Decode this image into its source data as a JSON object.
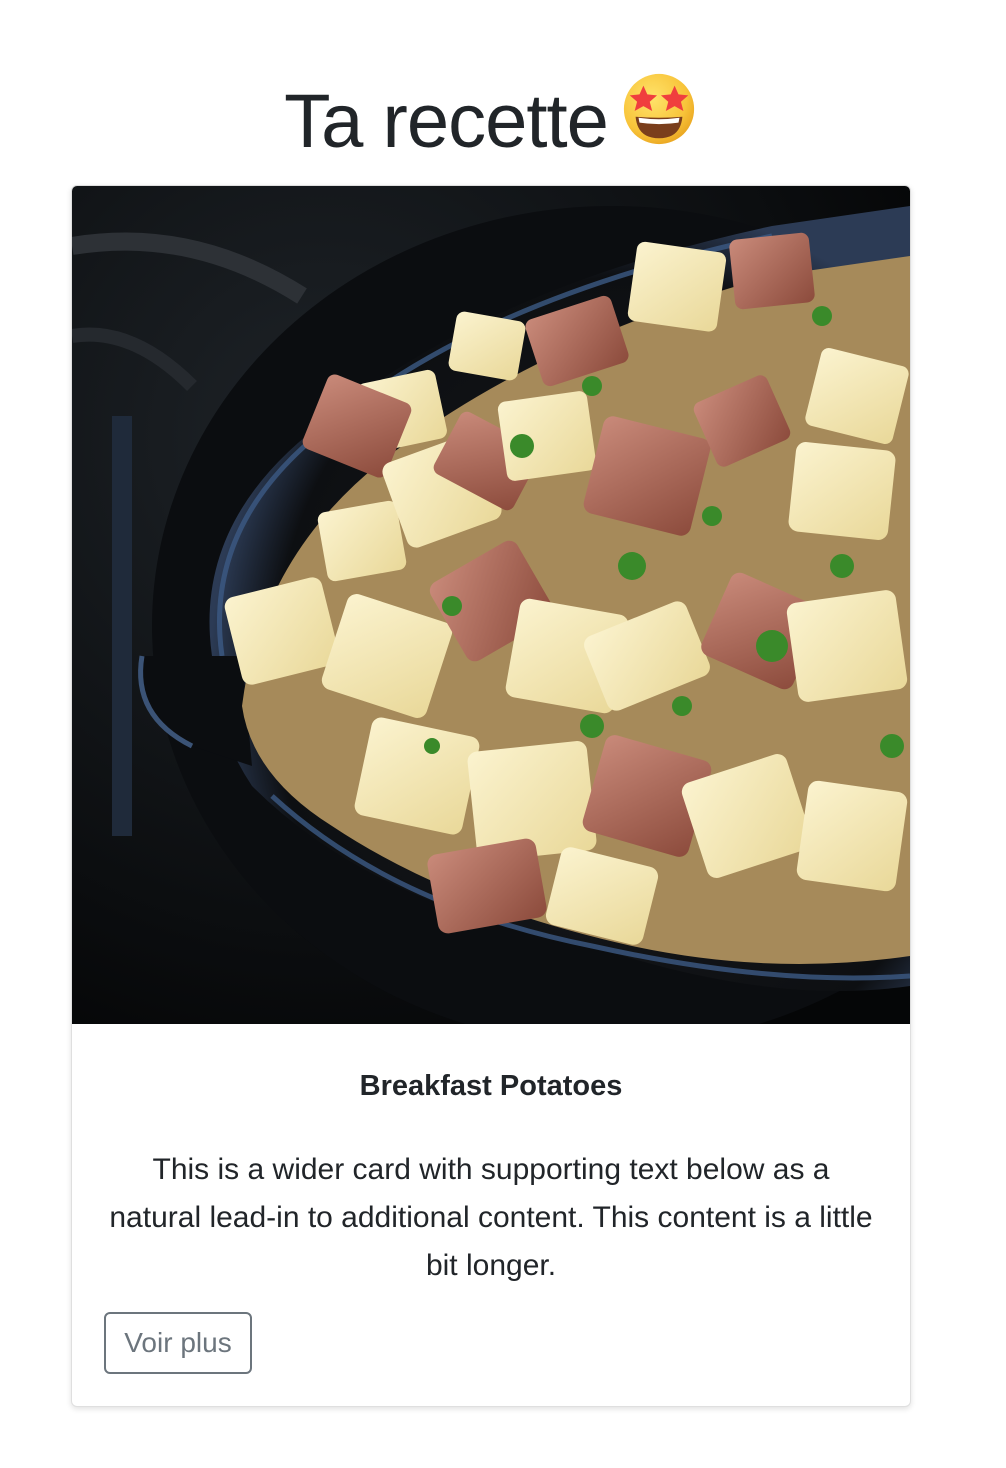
{
  "header": {
    "title": "Ta recette",
    "emoji_icon": "star-struck-emoji-icon"
  },
  "card": {
    "image_alt": "Breakfast Potatoes in a cast iron skillet",
    "title": "Breakfast Potatoes",
    "text": "This is a wider card with supporting text below as a natural lead-in to additional content. This content is a little bit longer.",
    "button_label": "Voir plus"
  },
  "colors": {
    "button_border": "#6c757d",
    "text": "#212529",
    "card_border": "#dfdfdf"
  }
}
